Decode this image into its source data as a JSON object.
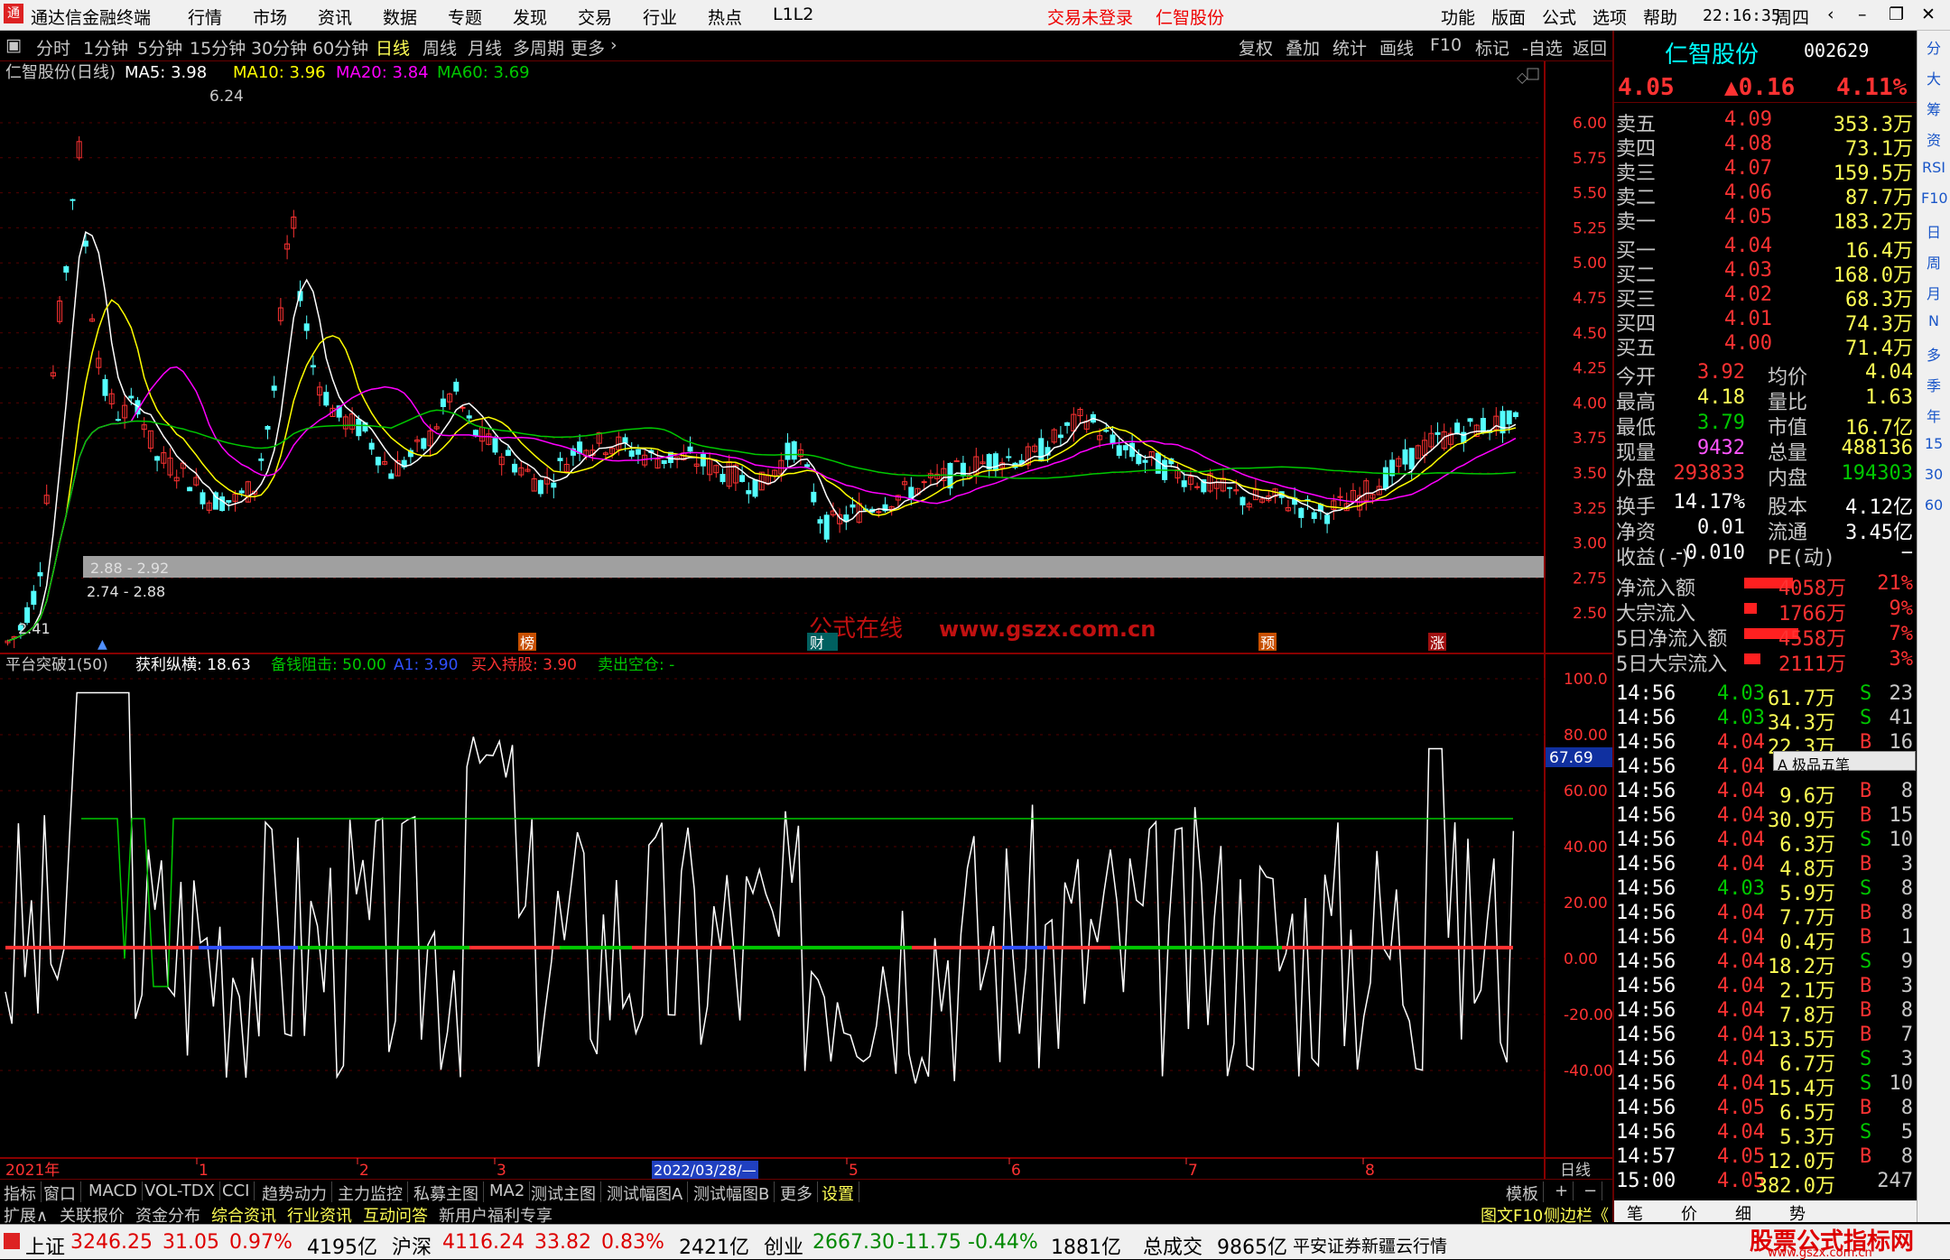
{
  "app": {
    "title": "通达信金融终端",
    "menu": [
      "行情",
      "市场",
      "资讯",
      "数据",
      "专题",
      "发现",
      "交易",
      "行业",
      "热点",
      "L1L2"
    ],
    "login_status": "交易未登录",
    "stock_center": "仁智股份",
    "right_menu": [
      "功能",
      "版面",
      "公式",
      "选项",
      "帮助"
    ],
    "time": "22:16:35",
    "weekday": "周四"
  },
  "periods": [
    "分时",
    "1分钟",
    "5分钟",
    "15分钟",
    "30分钟",
    "60分钟",
    "日线",
    "周线",
    "月线",
    "多周期",
    "更多"
  ],
  "active_period": "日线",
  "chart_tools": [
    "复权",
    "叠加",
    "统计",
    "画线",
    "F10",
    "标记",
    "-自选",
    "返回"
  ],
  "main_legend": {
    "name": "仁智股份(日线)",
    "ma5": "MA5: 3.98",
    "ma10": "MA10: 3.96",
    "ma20": "MA20: 3.84",
    "ma60": "MA60: 3.69"
  },
  "colors": {
    "up": "#ff3232",
    "down": "#54ffff",
    "ma5": "#ffffff",
    "ma10": "#ffff00",
    "ma20": "#ff00ff",
    "ma60": "#00c800",
    "grid": "#880000"
  },
  "price_axis": [
    "6.00",
    "5.75",
    "5.50",
    "5.25",
    "5.00",
    "4.75",
    "4.50",
    "4.25",
    "4.00",
    "3.75",
    "3.50",
    "3.25",
    "3.00",
    "2.75",
    "2.50"
  ],
  "annotations": {
    "high": "6.24",
    "low": "2.41",
    "range_low": "2.88 - 2.92",
    "range_low2": "2.74 - 2.88",
    "watermark1": "公式在线",
    "watermark2": "www.gszx.com.cn",
    "markers": [
      "榜",
      "财",
      "预",
      "涨"
    ]
  },
  "indicator_legend": {
    "name": "平台突破1(50)",
    "p1": "获利纵横: 18.63",
    "p2": "备钱阻击: 50.00",
    "p3": "A1: 3.90",
    "p4": "买入持股: 3.90",
    "p5": "卖出空仓: -"
  },
  "indicator_axis": [
    "100.0",
    "80.00",
    "60.00",
    "40.00",
    "20.00",
    "0.00",
    "-20.00",
    "-40.00"
  ],
  "indicator_cursor": "67.69",
  "x_axis": {
    "year": "2021年",
    "months": [
      "1",
      "2",
      "3",
      "5",
      "6",
      "7",
      "8"
    ],
    "cursor_date": "2022/03/28/—",
    "right": "日线"
  },
  "tabs_row1": [
    "指标",
    "窗口",
    "MACD",
    "VOL-TDX",
    "CCI",
    "趋势动力",
    "主力监控",
    "私募主图",
    "MA2",
    "测试主图",
    "测试幅图A",
    "测试幅图B",
    "更多",
    "设置"
  ],
  "tabs_row1_right": [
    "模板",
    "+",
    "−"
  ],
  "tabs_row2": [
    "扩展∧",
    "关联报价",
    "资金分布",
    "综合资讯",
    "行业资讯",
    "互动问答",
    "新用户福利专享"
  ],
  "tabs_row2_right": [
    "图文F10",
    "侧边栏《"
  ],
  "quote_panel": {
    "name": "仁智股份",
    "code": "002629",
    "price": "4.05",
    "change": "▲0.16",
    "pct": "4.11%",
    "asks": [
      {
        "l": "卖五",
        "p": "4.09",
        "v": "353.3万"
      },
      {
        "l": "卖四",
        "p": "4.08",
        "v": "73.1万"
      },
      {
        "l": "卖三",
        "p": "4.07",
        "v": "159.5万"
      },
      {
        "l": "卖二",
        "p": "4.06",
        "v": "87.7万"
      },
      {
        "l": "卖一",
        "p": "4.05",
        "v": "183.2万"
      }
    ],
    "bids": [
      {
        "l": "买一",
        "p": "4.04",
        "v": "16.4万"
      },
      {
        "l": "买二",
        "p": "4.03",
        "v": "168.0万"
      },
      {
        "l": "买三",
        "p": "4.02",
        "v": "68.3万"
      },
      {
        "l": "买四",
        "p": "4.01",
        "v": "74.3万"
      },
      {
        "l": "买五",
        "p": "4.00",
        "v": "71.4万"
      }
    ],
    "stats": [
      [
        "今开",
        "3.92",
        "均价",
        "4.04"
      ],
      [
        "最高",
        "4.18",
        "量比",
        "1.63"
      ],
      [
        "最低",
        "3.79",
        "市值",
        "16.7亿"
      ],
      [
        "现量",
        "9432",
        "总量",
        "488136"
      ],
      [
        "外盘",
        "293833",
        "内盘",
        "194303"
      ]
    ],
    "stats2": [
      [
        "换手",
        "14.17%",
        "股本",
        "4.12亿"
      ],
      [
        "净资",
        "0.01",
        "流通",
        "3.45亿"
      ],
      [
        "收益(-)",
        "-0.010",
        "PE(动)",
        "−"
      ]
    ],
    "flows": [
      [
        "净流入额",
        "4058万",
        "21%"
      ],
      [
        "大宗流入",
        "1766万",
        "9%"
      ],
      [
        "5日净流入额",
        "4558万",
        "7%"
      ],
      [
        "5日大宗流入",
        "2111万",
        "3%"
      ]
    ],
    "ticks": [
      [
        "14:56",
        "4.03",
        "61.7万",
        "S",
        "23"
      ],
      [
        "14:56",
        "4.03",
        "34.3万",
        "S",
        "41"
      ],
      [
        "14:56",
        "4.04",
        "22.3万",
        "B",
        "16"
      ],
      [
        "14:56",
        "4.04",
        "",
        "",
        ""
      ],
      [
        "14:56",
        "4.04",
        "9.6万",
        "B",
        "8"
      ],
      [
        "14:56",
        "4.04",
        "30.9万",
        "B",
        "15"
      ],
      [
        "14:56",
        "4.04",
        "6.3万",
        "S",
        "10"
      ],
      [
        "14:56",
        "4.04",
        "4.8万",
        "B",
        "3"
      ],
      [
        "14:56",
        "4.03",
        "5.9万",
        "S",
        "8"
      ],
      [
        "14:56",
        "4.04",
        "7.7万",
        "B",
        "8"
      ],
      [
        "14:56",
        "4.04",
        "0.4万",
        "B",
        "1"
      ],
      [
        "14:56",
        "4.04",
        "18.2万",
        "S",
        "9"
      ],
      [
        "14:56",
        "4.04",
        "2.1万",
        "B",
        "3"
      ],
      [
        "14:56",
        "4.04",
        "7.8万",
        "B",
        "8"
      ],
      [
        "14:56",
        "4.04",
        "13.5万",
        "B",
        "7"
      ],
      [
        "14:56",
        "4.04",
        "6.7万",
        "S",
        "3"
      ],
      [
        "14:56",
        "4.04",
        "15.4万",
        "S",
        "10"
      ],
      [
        "14:56",
        "4.05",
        "6.5万",
        "B",
        "8"
      ],
      [
        "14:56",
        "4.04",
        "5.3万",
        "S",
        "5"
      ],
      [
        "14:57",
        "4.05",
        "12.0万",
        "B",
        "8"
      ],
      [
        "15:00",
        "4.05",
        "382.0万",
        "",
        "247"
      ]
    ],
    "popup": "A 极品五笔",
    "bottom_tabs": [
      "笔",
      "价",
      "细",
      "势"
    ]
  },
  "right_tools": [
    "分",
    "大",
    "筹",
    "资",
    "RSI",
    "F10",
    "日",
    "周",
    "月",
    "N",
    "多",
    "季",
    "年",
    "15",
    "30",
    "60"
  ],
  "statusbar": {
    "sh": "上证",
    "sh_v": "3246.25",
    "sh_c": "31.05",
    "sh_p": "0.97%",
    "sh_a": "4195亿",
    "sz": "沪深",
    "sz_v": "4116.24",
    "sz_c": "33.82",
    "sz_p": "0.83%",
    "sz_a": "2421亿",
    "cy": "创业",
    "cy_v": "2667.30",
    "cy_c": "-11.75",
    "cy_p": "-0.44%",
    "cy_a": "1881亿",
    "total": "总成交",
    "total_v": "9865亿",
    "broker": "平安证券新疆云行情",
    "logo": "股票公式指标网",
    "logo_url": "www.gszx.com.cn"
  }
}
